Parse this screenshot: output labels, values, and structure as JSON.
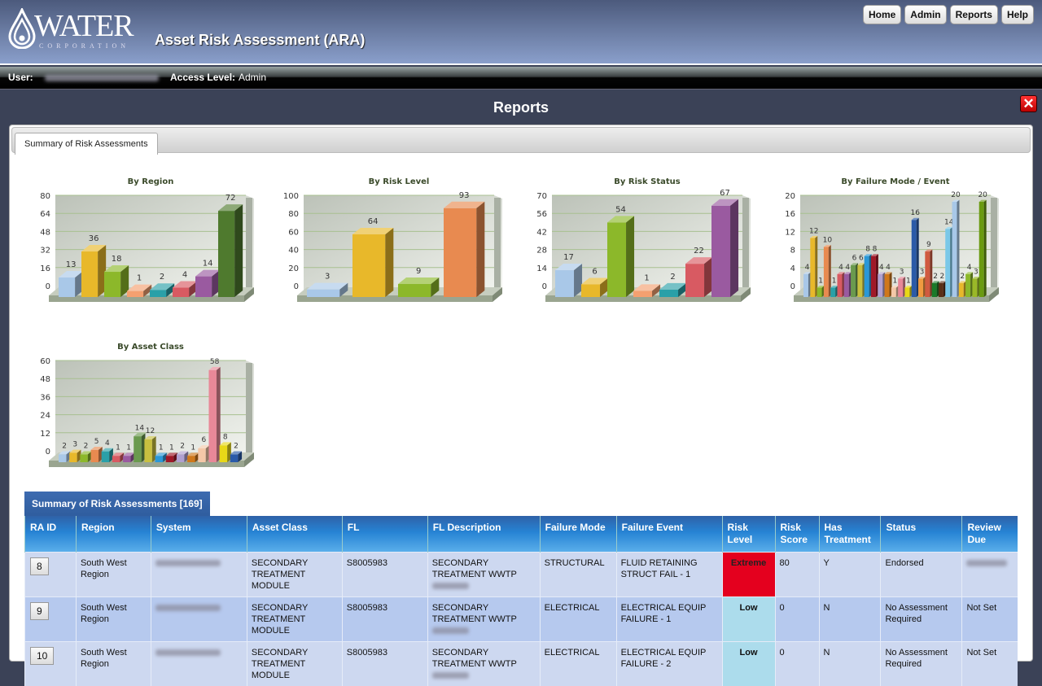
{
  "header": {
    "logo_word": "WATER",
    "logo_sub": "CORPORATION",
    "title": "Asset Risk Assessment (ARA)",
    "nav": [
      "Home",
      "Admin",
      "Reports",
      "Help"
    ]
  },
  "userbar": {
    "user_label": "User:",
    "access_label": "Access Level:",
    "access_value": "Admin"
  },
  "page": {
    "title": "Reports",
    "close_icon": "close-icon"
  },
  "tabs": [
    "Summary of Risk Assessments"
  ],
  "chart_data": [
    {
      "type": "bar",
      "title": "By Region",
      "ylim": [
        0,
        80
      ],
      "ticks": [
        0,
        16,
        32,
        48,
        64,
        80
      ],
      "values": [
        13,
        36,
        18,
        1,
        2,
        4,
        14,
        72
      ],
      "colors": [
        "#a9c8e8",
        "#e8b82a",
        "#8cb82a",
        "#f4a070",
        "#2aa0a8",
        "#d85a62",
        "#9a5aa0",
        "#4f7a2e"
      ],
      "grid": true
    },
    {
      "type": "bar",
      "title": "By Risk Level",
      "ylim": [
        0,
        100
      ],
      "ticks": [
        0,
        20,
        40,
        60,
        80,
        100
      ],
      "values": [
        3,
        64,
        9,
        93
      ],
      "colors": [
        "#a9c8e8",
        "#e8b82a",
        "#8cb82a",
        "#e88a50"
      ],
      "grid": true
    },
    {
      "type": "bar",
      "title": "By Risk Status",
      "ylim": [
        0,
        70
      ],
      "ticks": [
        0,
        14,
        28,
        42,
        56,
        70
      ],
      "values": [
        17,
        6,
        54,
        1,
        2,
        22,
        67
      ],
      "colors": [
        "#a9c8e8",
        "#e8b82a",
        "#8cb82a",
        "#f4a070",
        "#2aa0a8",
        "#d85a62",
        "#9a5aa0"
      ],
      "grid": true
    },
    {
      "type": "bar",
      "title": "By Failure Mode / Event",
      "ylim": [
        0,
        20
      ],
      "ticks": [
        0,
        4,
        8,
        12,
        16,
        20
      ],
      "values": [
        4,
        12,
        1,
        10,
        1,
        4,
        4,
        6,
        6,
        8,
        8,
        4,
        4,
        1,
        3,
        1,
        16,
        3,
        9,
        2,
        2,
        14,
        20,
        2,
        4,
        3,
        20
      ],
      "colors": [
        "#a9c8e8",
        "#e8b82a",
        "#8cb82a",
        "#e88a50",
        "#2aa0a8",
        "#d85a62",
        "#9a5aa0",
        "#6a9a4e",
        "#c8c040",
        "#2a98d8",
        "#a01828",
        "#b0a0d0",
        "#d0781a",
        "#f4c8a8",
        "#e88898",
        "#e8d818",
        "#2a5aa8",
        "#f09a40",
        "#d05a40",
        "#1a7a2a",
        "#5a3018",
        "#7ac8e8",
        "#a8c8e8",
        "#e8b82a",
        "#8cb82a",
        "#9ab828",
        "#6a9a10"
      ],
      "grid": true
    },
    {
      "type": "bar",
      "title": "By Asset Class",
      "ylim": [
        0,
        60
      ],
      "ticks": [
        0,
        12,
        24,
        36,
        48,
        60
      ],
      "values": [
        2,
        3,
        2,
        5,
        4,
        1,
        1,
        14,
        12,
        1,
        1,
        2,
        1,
        6,
        58,
        8,
        2
      ],
      "colors": [
        "#a9c8e8",
        "#e8b82a",
        "#8cb82a",
        "#e88a50",
        "#2aa0a8",
        "#d85a62",
        "#9a5aa0",
        "#6a9a4e",
        "#c8c040",
        "#2a98d8",
        "#a01828",
        "#b0a0d0",
        "#d0781a",
        "#f4c8a8",
        "#e88898",
        "#e8d818",
        "#2a5aa8"
      ],
      "grid": true
    }
  ],
  "table": {
    "caption": "Summary of Risk Assessments [169]",
    "columns": [
      "RA ID",
      "Region",
      "System",
      "Asset Class",
      "FL",
      "FL Description",
      "Failure Mode",
      "Failure Event",
      "Risk Level",
      "Risk Score",
      "Has Treatment",
      "Status",
      "Review Due"
    ],
    "rows": [
      {
        "id": "8",
        "region": "South West Region",
        "asset_class": "SECONDARY TREATMENT MODULE",
        "fl": "S8005983",
        "fl_desc": "SECONDARY TREATMENT WWTP",
        "failure_mode": "STRUCTURAL",
        "failure_event": "FLUID RETAINING STRUCT FAIL - 1",
        "risk_level": "Extreme",
        "risk_score": "80",
        "has_treatment": "Y",
        "status": "Endorsed",
        "review_due": ""
      },
      {
        "id": "9",
        "region": "South West Region",
        "asset_class": "SECONDARY TREATMENT MODULE",
        "fl": "S8005983",
        "fl_desc": "SECONDARY TREATMENT WWTP",
        "failure_mode": "ELECTRICAL",
        "failure_event": "ELECTRICAL EQUIP FAILURE - 1",
        "risk_level": "Low",
        "risk_score": "0",
        "has_treatment": "N",
        "status": "No Assessment Required",
        "review_due": "Not Set"
      },
      {
        "id": "10",
        "region": "South West Region",
        "asset_class": "SECONDARY TREATMENT MODULE",
        "fl": "S8005983",
        "fl_desc": "SECONDARY TREATMENT WWTP",
        "failure_mode": "ELECTRICAL",
        "failure_event": "ELECTRICAL EQUIP FAILURE - 2",
        "risk_level": "Low",
        "risk_score": "0",
        "has_treatment": "N",
        "status": "No Assessment Required",
        "review_due": "Not Set"
      }
    ]
  },
  "colors": {
    "extreme": "#e4001e",
    "low": "#acdcec",
    "header_blue": "#2683d4"
  }
}
